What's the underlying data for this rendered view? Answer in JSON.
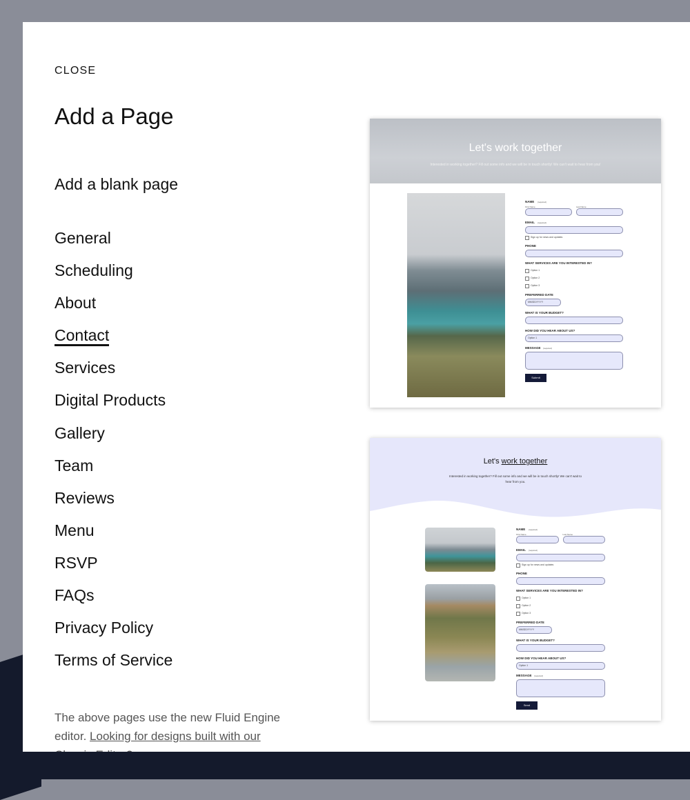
{
  "close_label": "CLOSE",
  "title": "Add a Page",
  "blank_page_label": "Add a blank page",
  "categories": [
    "General",
    "Scheduling",
    "About",
    "Contact",
    "Services",
    "Digital Products",
    "Gallery",
    "Team",
    "Reviews",
    "Menu",
    "RSVP",
    "FAQs",
    "Privacy Policy",
    "Terms of Service"
  ],
  "active_category": "Contact",
  "footnote": {
    "text": "The above pages use the new Fluid Engine editor. ",
    "link": "Looking for designs built with our Classic Editor?"
  },
  "templates": [
    {
      "heading": "Let's work together",
      "subtext": "Interested in working together? Fill out some info and we will be in touch shortly! We can't wait to hear from you!"
    },
    {
      "heading_plain": "Let's",
      "heading_underlined": "work together",
      "subtext": "Interested in working together? Fill out some info and we will be in touch shortly! We can't wait to hear from you."
    }
  ],
  "form": {
    "name": "NAME",
    "required": "(required)",
    "first_name": "First Name",
    "last_name": "Last Name",
    "email": "EMAIL",
    "signup": "Sign up for news and updates",
    "phone": "PHONE",
    "services": "WHAT SERVICES ARE YOU INTERESTED IN?",
    "option1": "Option 1",
    "option2": "Option 2",
    "option3": "Option 3",
    "date": "PREFERRED DATE",
    "date_placeholder": "MM/DD/YYYY",
    "budget": "WHAT IS YOUR BUDGET?",
    "hear": "HOW DID YOU HEAR ABOUT US?",
    "hear_selected": "Option 1",
    "message": "MESSAGE",
    "submit1": "Submit",
    "submit2": "Send"
  },
  "colors": {
    "accent_dark": "#141a38",
    "field_fill": "#e6e8fb",
    "hero2_bg": "#e6e7fb"
  }
}
